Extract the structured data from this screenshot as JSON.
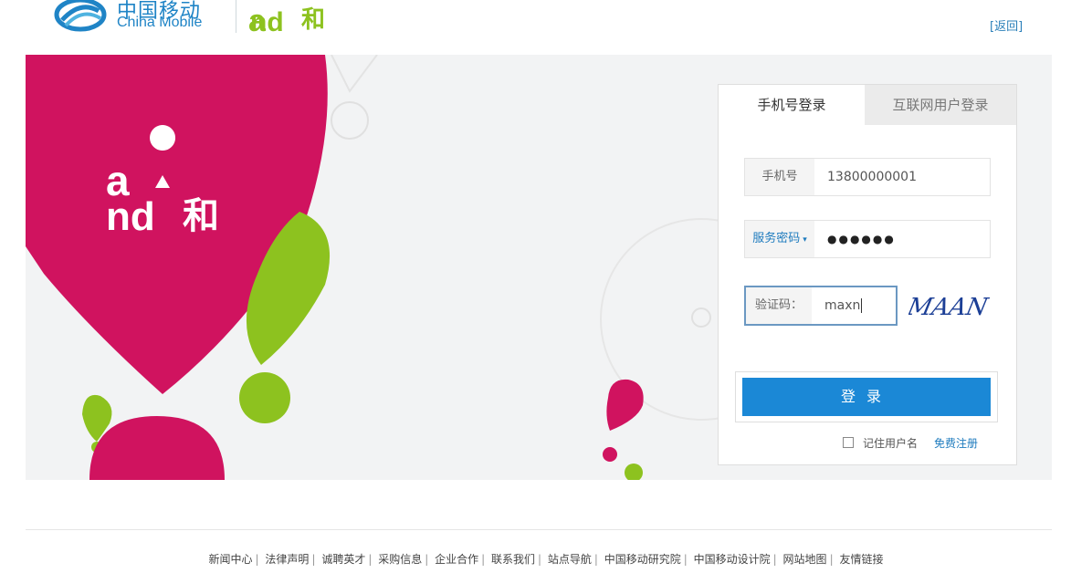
{
  "header": {
    "brand_cn": "中国移动",
    "brand_en": "China Mobile",
    "sub_brand_text": "and和",
    "lang_link": "[返回]"
  },
  "banner": {
    "logo_text": "and和",
    "colors": {
      "magenta": "#d0135f",
      "green": "#8dc21f",
      "background": "#f2f3f4"
    }
  },
  "login": {
    "tabs": [
      {
        "label": "手机号登录",
        "active": true
      },
      {
        "label": "互联网用户登录",
        "active": false
      }
    ],
    "phone": {
      "label": "手机号",
      "value": "13800000001"
    },
    "password": {
      "label": "服务密码",
      "value": "●●●●●●"
    },
    "captcha": {
      "label": "验证码：",
      "value": "maxn",
      "image_text": "MAAN"
    },
    "submit_label": "登录",
    "remember_label": "记住用户名",
    "register_label": "免费注册",
    "accent": "#1b88d6"
  },
  "footer": {
    "links": [
      "新闻中心",
      "法律声明",
      "诚聘英才",
      "采购信息",
      "企业合作",
      "联系我们",
      "站点导航",
      "中国移动研究院",
      "中国移动设计院",
      "网站地图",
      "友情链接"
    ]
  }
}
